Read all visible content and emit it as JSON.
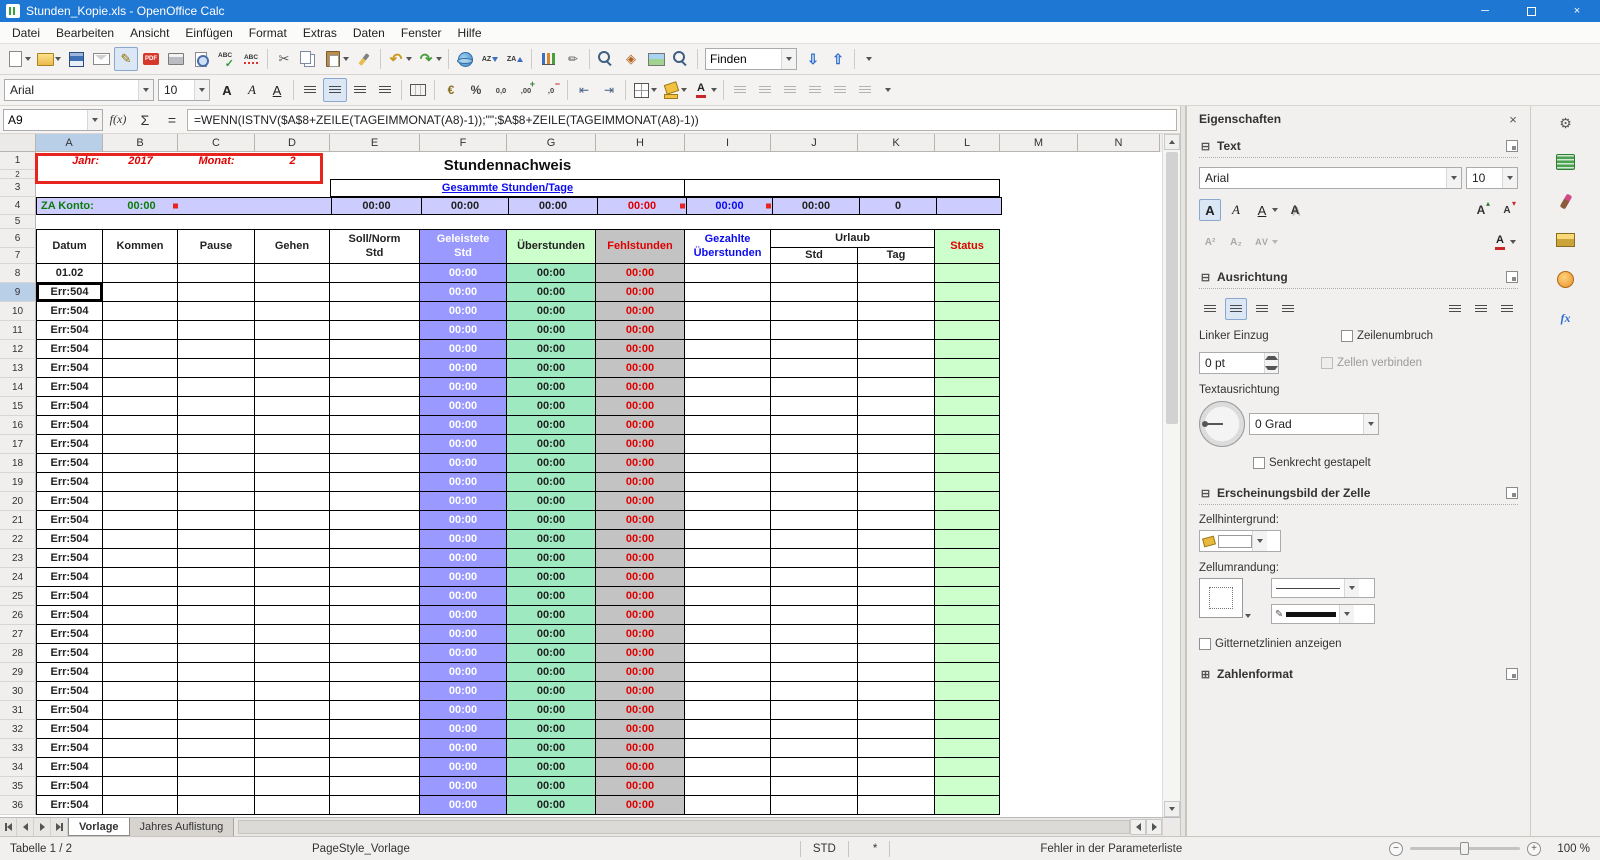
{
  "window": {
    "title": "Stunden_Kopie.xls - OpenOffice Calc"
  },
  "menubar": [
    "Datei",
    "Bearbeiten",
    "Ansicht",
    "Einfügen",
    "Format",
    "Extras",
    "Daten",
    "Fenster",
    "Hilfe"
  ],
  "standard_toolbar": {
    "buttons": [
      "new",
      "open",
      "save",
      "email",
      "edit-file",
      "export-pdf",
      "print",
      "page-preview",
      "spellcheck",
      "auto-spellcheck",
      "|",
      "cut",
      "copy",
      "paste",
      "format-paintbrush",
      "|",
      "undo",
      "redo",
      "|",
      "hyperlink",
      "sort-ascending",
      "sort-descending",
      "|",
      "insert-chart",
      "draw-functions",
      "|",
      "find-replace",
      "navigator",
      "gallery",
      "zoom",
      "|"
    ],
    "dropdowns": [
      "new",
      "open",
      "paste",
      "undo",
      "redo"
    ],
    "active": [
      "edit-file"
    ],
    "disabled": [],
    "find_value": "Finden",
    "find_buttons": [
      "find-down",
      "find-up"
    ]
  },
  "format_toolbar": {
    "font_name": "Arial",
    "font_size": "10",
    "buttons": [
      "bold",
      "italic",
      "underline",
      "|",
      "align-left",
      "align-center",
      "align-right",
      "align-justify",
      "|",
      "merge-cells",
      "|",
      "currency",
      "percent",
      "standard-format",
      "add-decimal",
      "delete-decimal",
      "|",
      "decrease-indent",
      "increase-indent",
      "|",
      "borders",
      "background-color",
      "font-color",
      "|",
      "valign-top",
      "valign-center",
      "valign-bottom",
      "wrap-text",
      "freeze",
      "split-window"
    ],
    "dropdowns": [
      "borders",
      "background-color",
      "font-color"
    ],
    "active": [
      "align-center"
    ],
    "disabled": [
      "valign-top",
      "valign-center",
      "valign-bottom",
      "wrap-text",
      "freeze",
      "split-window"
    ]
  },
  "formula_bar": {
    "cell_reference": "A9",
    "formula": "=WENN(ISTNV($A$8+ZEILE(TAGEIMMONAT(A8)-1));\"\";$A$8+ZEILE(TAGEIMMONAT(A8)-1))"
  },
  "grid": {
    "columns": [
      "A",
      "B",
      "C",
      "D",
      "E",
      "F",
      "G",
      "H",
      "I",
      "J",
      "K",
      "L",
      "M",
      "N"
    ],
    "selected_column": "A",
    "selected_row_number": 9,
    "first_data_row_number": 8,
    "gutter_numbers": [
      "1",
      "2",
      "3",
      "4",
      "5",
      "6",
      "7"
    ],
    "row1": {
      "jahr_label": "Jahr:",
      "jahr_value": "2017",
      "monat_label": "Monat:",
      "monat_value": "2",
      "title": "Stundennachweis"
    },
    "row3": {
      "summary_title": "Gesammte Stunden/Tage"
    },
    "row4": {
      "za_label": "ZA Konto:",
      "za_value": "00:00",
      "e": "00:00",
      "f": "00:00",
      "g": "00:00",
      "h": "00:00",
      "i": "00:00",
      "j": "00:00",
      "k": "0"
    },
    "headers": {
      "datum": "Datum",
      "kommen": "Kommen",
      "pause": "Pause",
      "gehen": "Gehen",
      "soll_line1": "Soll/Norm",
      "soll_line2": "Std",
      "geleistete_line1": "Geleistete",
      "geleistete_line2": "Std",
      "ueberstunden": "Überstunden",
      "fehlstunden": "Fehlstunden",
      "gezahlte_line1": "Gezahlte",
      "gezahlte_line2": "Überstunden",
      "urlaub": "Urlaub",
      "urlaub_std": "Std",
      "urlaub_tag": "Tag",
      "status": "Status"
    },
    "data_rows": [
      {
        "datum": "01.02",
        "f": "00:00",
        "g": "00:00",
        "h": "00:00"
      },
      {
        "datum": "Err:504",
        "f": "00:00",
        "g": "00:00",
        "h": "00:00"
      },
      {
        "datum": "Err:504",
        "f": "00:00",
        "g": "00:00",
        "h": "00:00"
      },
      {
        "datum": "Err:504",
        "f": "00:00",
        "g": "00:00",
        "h": "00:00"
      },
      {
        "datum": "Err:504",
        "f": "00:00",
        "g": "00:00",
        "h": "00:00"
      },
      {
        "datum": "Err:504",
        "f": "00:00",
        "g": "00:00",
        "h": "00:00"
      },
      {
        "datum": "Err:504",
        "f": "00:00",
        "g": "00:00",
        "h": "00:00"
      },
      {
        "datum": "Err:504",
        "f": "00:00",
        "g": "00:00",
        "h": "00:00"
      },
      {
        "datum": "Err:504",
        "f": "00:00",
        "g": "00:00",
        "h": "00:00"
      },
      {
        "datum": "Err:504",
        "f": "00:00",
        "g": "00:00",
        "h": "00:00"
      },
      {
        "datum": "Err:504",
        "f": "00:00",
        "g": "00:00",
        "h": "00:00"
      },
      {
        "datum": "Err:504",
        "f": "00:00",
        "g": "00:00",
        "h": "00:00"
      },
      {
        "datum": "Err:504",
        "f": "00:00",
        "g": "00:00",
        "h": "00:00"
      },
      {
        "datum": "Err:504",
        "f": "00:00",
        "g": "00:00",
        "h": "00:00"
      },
      {
        "datum": "Err:504",
        "f": "00:00",
        "g": "00:00",
        "h": "00:00"
      },
      {
        "datum": "Err:504",
        "f": "00:00",
        "g": "00:00",
        "h": "00:00"
      },
      {
        "datum": "Err:504",
        "f": "00:00",
        "g": "00:00",
        "h": "00:00"
      },
      {
        "datum": "Err:504",
        "f": "00:00",
        "g": "00:00",
        "h": "00:00"
      },
      {
        "datum": "Err:504",
        "f": "00:00",
        "g": "00:00",
        "h": "00:00"
      },
      {
        "datum": "Err:504",
        "f": "00:00",
        "g": "00:00",
        "h": "00:00"
      },
      {
        "datum": "Err:504",
        "f": "00:00",
        "g": "00:00",
        "h": "00:00"
      },
      {
        "datum": "Err:504",
        "f": "00:00",
        "g": "00:00",
        "h": "00:00"
      },
      {
        "datum": "Err:504",
        "f": "00:00",
        "g": "00:00",
        "h": "00:00"
      },
      {
        "datum": "Err:504",
        "f": "00:00",
        "g": "00:00",
        "h": "00:00"
      },
      {
        "datum": "Err:504",
        "f": "00:00",
        "g": "00:00",
        "h": "00:00"
      },
      {
        "datum": "Err:504",
        "f": "00:00",
        "g": "00:00",
        "h": "00:00"
      },
      {
        "datum": "Err:504",
        "f": "00:00",
        "g": "00:00",
        "h": "00:00"
      },
      {
        "datum": "Err:504",
        "f": "00:00",
        "g": "00:00",
        "h": "00:00"
      },
      {
        "datum": "Err:504",
        "f": "00:00",
        "g": "00:00",
        "h": "00:00"
      }
    ]
  },
  "sidebar": {
    "title": "Eigenschaften",
    "text_section": {
      "label": "Text",
      "font_name": "Arial",
      "font_size": "10"
    },
    "alignment_section": {
      "label": "Ausrichtung",
      "left_indent_label": "Linker Einzug",
      "left_indent_value": "0 pt",
      "wrap_label": "Zeilenumbruch",
      "merge_label": "Zellen verbinden",
      "orientation_label": "Textausrichtung",
      "orientation_value": "0 Grad",
      "stacked_label": "Senkrecht gestapelt"
    },
    "cell_section": {
      "label": "Erscheinungsbild der Zelle",
      "background_label": "Zellhintergrund:",
      "border_label": "Zellumrandung:",
      "gridlines_label": "Gitternetzlinien anzeigen"
    },
    "number_section": {
      "label": "Zahlenformat"
    }
  },
  "sheet_tabs": {
    "tabs": [
      {
        "label": "Vorlage",
        "active": true
      },
      {
        "label": "Jahres Auflistung",
        "active": false
      }
    ]
  },
  "statusbar": {
    "sheet_info": "Tabelle 1 / 2",
    "page_style": "PageStyle_Vorlage",
    "mode": "STD",
    "modified": "*",
    "message": "Fehler in der Parameterliste",
    "zoom_level": "100 %"
  },
  "colors": {
    "titlebar": "#1f77d4",
    "purple_column": "#9999ff",
    "mint_column": "#9fe9c0",
    "gray_column": "#c3c3c3",
    "light_green_column": "#ccffcc",
    "lavender_row": "#ccccff",
    "annotation_red": "#e8241f",
    "red_text": "#e00000",
    "blue_text": "#0b0bf0",
    "green_text": "#0a7d0a"
  }
}
